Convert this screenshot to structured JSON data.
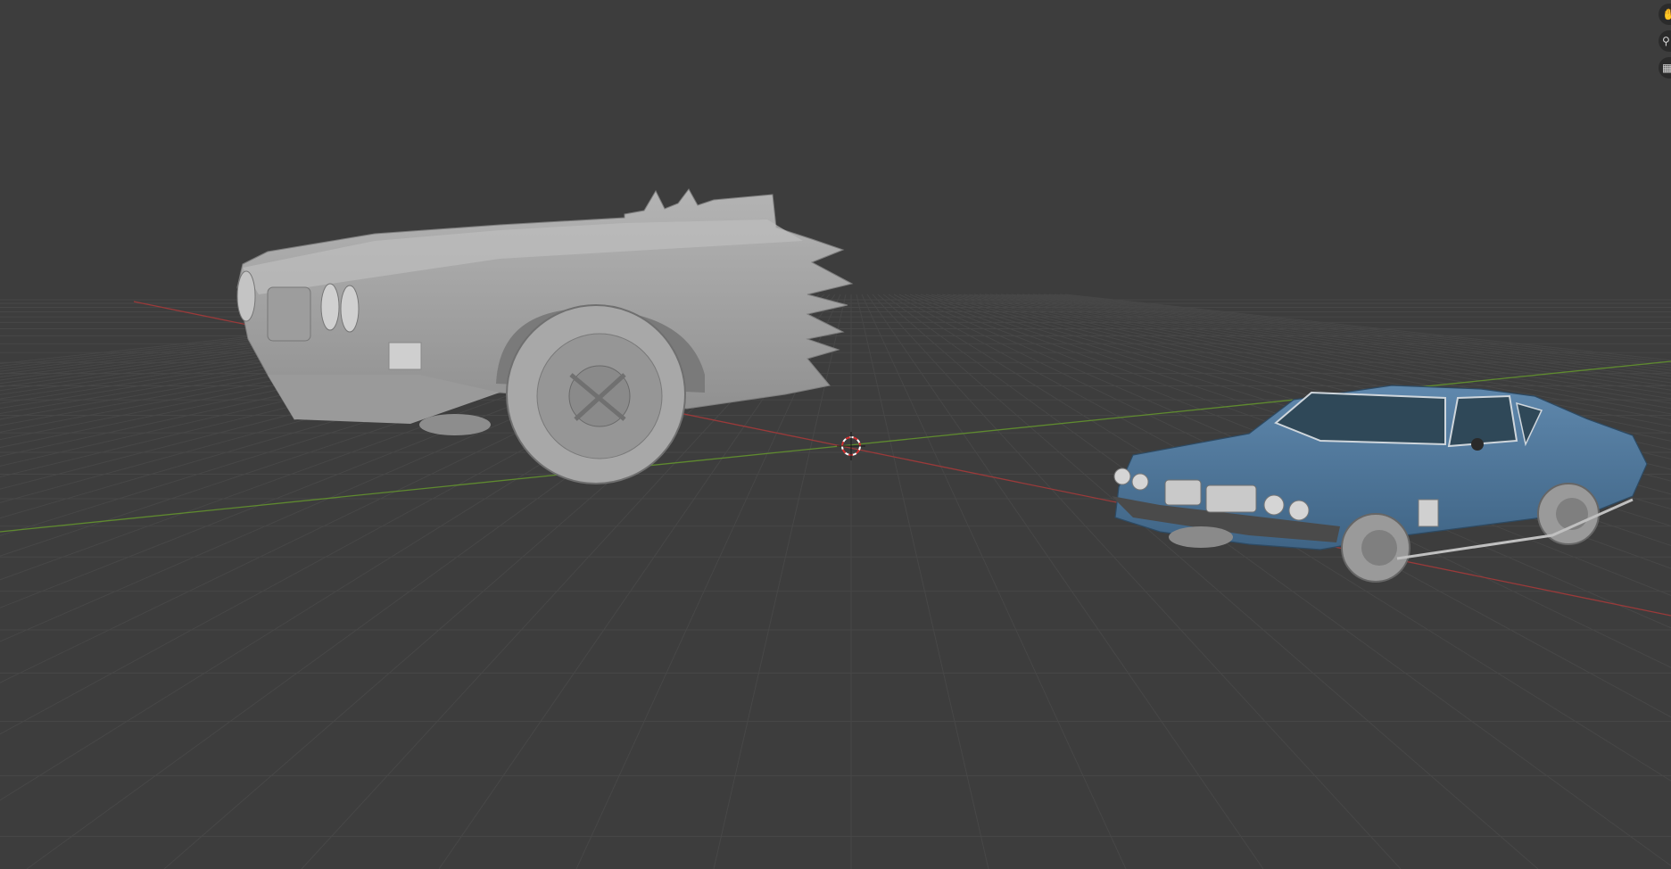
{
  "app": "Blender",
  "viewport": {
    "background_color": "#3d3d3d",
    "grid_color": "#4a4a4a",
    "x_axis_color": "#9a3a3a",
    "y_axis_color": "#5f8a2f",
    "cursor": "3d-cursor-icon"
  },
  "objects": [
    {
      "name": "deformed-car",
      "shading": "solid",
      "color": "#a7a7a7"
    },
    {
      "name": "textured-car",
      "shading": "material-preview",
      "color": "#4e7597"
    }
  ],
  "gizmos": [
    {
      "icon": "pan-hand-icon",
      "glyph": "✋"
    },
    {
      "icon": "camera-view-icon",
      "glyph": "⚲"
    },
    {
      "icon": "perspective-grid-icon",
      "glyph": "▦"
    }
  ]
}
